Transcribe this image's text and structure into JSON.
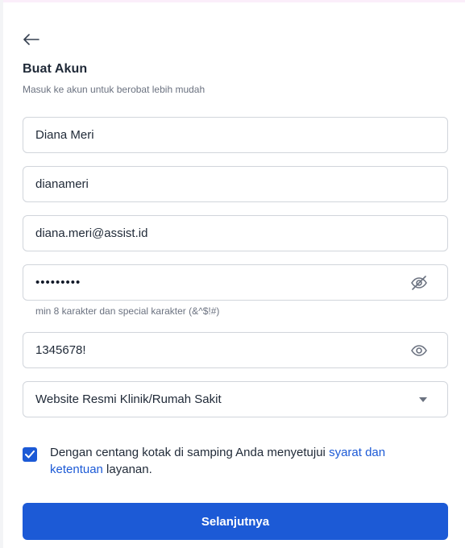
{
  "header": {
    "title": "Buat Akun",
    "subtitle": "Masuk ke akun untuk berobat lebih mudah"
  },
  "form": {
    "full_name": "Diana Meri",
    "username": "dianameri",
    "email": "diana.meri@assist.id",
    "password_masked": "•••••••••",
    "password_hint": "min 8 karakter dan special karakter (&^$!#)",
    "confirm_password": "1345678!",
    "source_select": "Website Resmi Klinik/Rumah Sakit"
  },
  "terms": {
    "checked": true,
    "text_before": "Dengan centang kotak di samping Anda menyetujui ",
    "link": "syarat dan ketentuan",
    "text_after": " layanan."
  },
  "submit_label": "Selanjutnya",
  "colors": {
    "primary": "#1c5ad6",
    "border": "#d1d5db",
    "muted": "#6b7280"
  },
  "icons": {
    "back": "arrow-left-icon",
    "password_toggle": "eye-off-icon",
    "confirm_toggle": "eye-icon",
    "select": "chevron-down-icon",
    "checkbox": "check-icon"
  }
}
